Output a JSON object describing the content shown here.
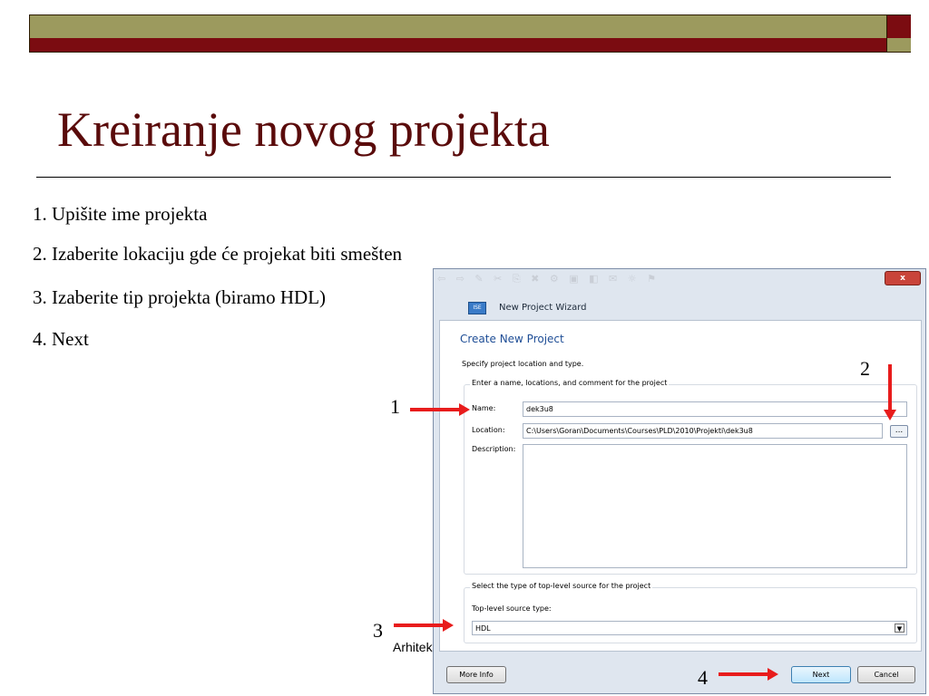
{
  "slide": {
    "title": "Kreiranje novog projekta",
    "bullets": [
      "1. Upišite ime projekta",
      "2. Izaberite lokaciju gde će projekat biti smešten",
      "3. Izaberite tip projekta (biramo HDL)",
      "4. Next"
    ],
    "footer": "Arhitek"
  },
  "wizard": {
    "window_title": "New Project Wizard",
    "close_label": "x",
    "app_icon": "ISE",
    "heading": "Create New Project",
    "subheading": "Specify project location and type.",
    "group1_label": "Enter a name, locations, and comment for the project",
    "name_label": "Name:",
    "name_value": "dek3u8",
    "location_label": "Location:",
    "location_value": "C:\\Users\\Goran\\Documents\\Courses\\PLD\\2010\\Projekti\\dek3u8",
    "browse_label": "...",
    "description_label": "Description:",
    "description_value": "",
    "group2_label": "Select the type of top-level source for the project",
    "toplevel_label": "Top-level source type:",
    "toplevel_value": "HDL",
    "more_info_label": "More Info",
    "next_label": "Next",
    "cancel_label": "Cancel"
  },
  "callouts": [
    "1",
    "2",
    "3",
    "4"
  ],
  "colors": {
    "title": "#5a0b0b",
    "olive": "#9c9a5e",
    "maroon": "#7b0c11",
    "arrow": "#e81c1c",
    "wizard_heading": "#1f4e96"
  }
}
